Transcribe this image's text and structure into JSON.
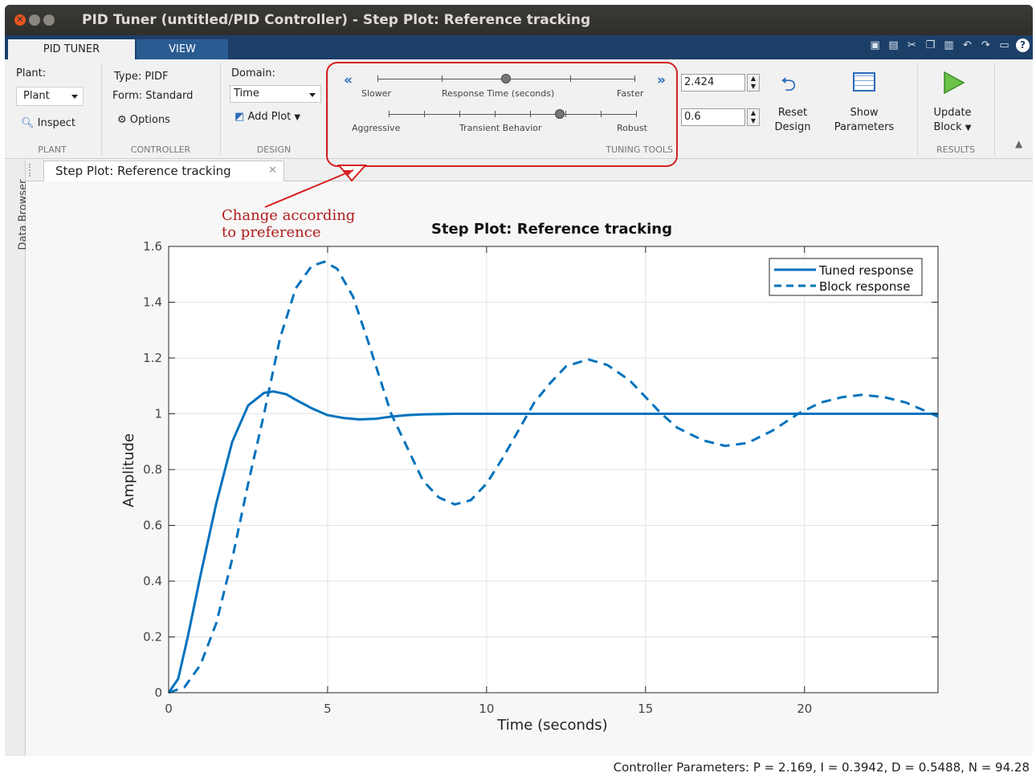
{
  "window": {
    "title": "PID Tuner (untitled/PID Controller) - Step Plot: Reference tracking"
  },
  "ribbon_tabs": [
    "PID TUNER",
    "VIEW"
  ],
  "quick_access": [
    "quick-access-dock-icon",
    "save-icon",
    "cut-icon",
    "copy-icon",
    "paste-icon",
    "undo-icon",
    "redo-icon",
    "window-icon",
    "help-icon"
  ],
  "ribbon": {
    "plant": {
      "label": "Plant:",
      "value": "Plant",
      "inspect": "Inspect",
      "section": "PLANT"
    },
    "controller": {
      "type": "Type: PIDF",
      "form": "Form: Standard",
      "options": "Options",
      "section": "CONTROLLER"
    },
    "design": {
      "domain_label": "Domain:",
      "domain_value": "Time",
      "add_plot": "Add Plot",
      "section": "DESIGN"
    },
    "tuning": {
      "slower": "Slower",
      "response_time": "Response Time (seconds)",
      "faster": "Faster",
      "aggressive": "Aggressive",
      "transient_behavior": "Transient Behavior",
      "robust": "Robust",
      "response_time_value": "2.424",
      "transient_value": "0.6",
      "response_slider_level": 0.5,
      "transient_slider_level": 0.69,
      "reset_design": [
        "Reset",
        "Design"
      ],
      "show_parameters": [
        "Show",
        "Parameters"
      ],
      "section": "TUNING TOOLS"
    },
    "results": {
      "update_block": [
        "Update",
        "Block"
      ],
      "section": "RESULTS"
    }
  },
  "doc_tab": "Step Plot: Reference tracking",
  "side_panel": "Data Browser",
  "annotation": [
    "Change  according",
    "to  preference"
  ],
  "status": "Controller Parameters: P = 2.169, I = 0.3942, D = 0.5488, N = 94.28",
  "colors": {
    "accent": "#1c3f68",
    "series": "#0072bd",
    "callout": "#d42020"
  },
  "chart_data": {
    "type": "line",
    "title": "Step Plot: Reference tracking",
    "xlabel": "Time (seconds)",
    "ylabel": "Amplitude",
    "xlim": [
      0,
      24.2
    ],
    "ylim": [
      0,
      1.6
    ],
    "xticks": [
      0,
      5,
      10,
      15,
      20
    ],
    "yticks": [
      0,
      0.2,
      0.4,
      0.6,
      0.8,
      1,
      1.2,
      1.4,
      1.6
    ],
    "ytick_labels": [
      "0",
      "0.2",
      "0.4",
      "0.6",
      "0.8",
      "1",
      "1.2",
      "1.4",
      "1.6"
    ],
    "grid": true,
    "legend_position": "top-right",
    "series": [
      {
        "name": "Tuned response",
        "style": "solid",
        "x": [
          0,
          0.3,
          0.6,
          1.0,
          1.5,
          2.0,
          2.5,
          3.0,
          3.3,
          3.7,
          4.0,
          4.5,
          5.0,
          5.5,
          6.0,
          6.5,
          7.0,
          7.5,
          8.0,
          9.0,
          10,
          12,
          15,
          20,
          24.2
        ],
        "y": [
          0,
          0.05,
          0.2,
          0.42,
          0.68,
          0.9,
          1.03,
          1.075,
          1.08,
          1.07,
          1.05,
          1.02,
          0.995,
          0.985,
          0.98,
          0.982,
          0.99,
          0.995,
          0.998,
          1.0,
          1.0,
          1.0,
          1.0,
          1.0,
          1.0
        ]
      },
      {
        "name": "Block response",
        "style": "dashed",
        "x": [
          0,
          0.5,
          1.0,
          1.5,
          2.0,
          2.5,
          3.0,
          3.5,
          4.0,
          4.5,
          4.9,
          5.3,
          5.8,
          6.3,
          7.0,
          7.5,
          8.0,
          8.5,
          9.0,
          9.5,
          10.0,
          10.5,
          11.0,
          11.5,
          12.0,
          12.5,
          13.2,
          13.8,
          14.5,
          15.0,
          15.5,
          16.0,
          16.8,
          17.5,
          18.2,
          19.0,
          19.8,
          20.5,
          21.2,
          21.8,
          22.5,
          23.2,
          24.2
        ],
        "y": [
          0,
          0.02,
          0.1,
          0.25,
          0.48,
          0.75,
          1.0,
          1.27,
          1.45,
          1.53,
          1.545,
          1.52,
          1.42,
          1.25,
          1.0,
          0.88,
          0.76,
          0.7,
          0.675,
          0.69,
          0.75,
          0.84,
          0.94,
          1.04,
          1.11,
          1.17,
          1.195,
          1.175,
          1.12,
          1.06,
          1.0,
          0.95,
          0.905,
          0.885,
          0.895,
          0.94,
          1.0,
          1.04,
          1.06,
          1.068,
          1.06,
          1.04,
          0.99
        ]
      }
    ]
  }
}
